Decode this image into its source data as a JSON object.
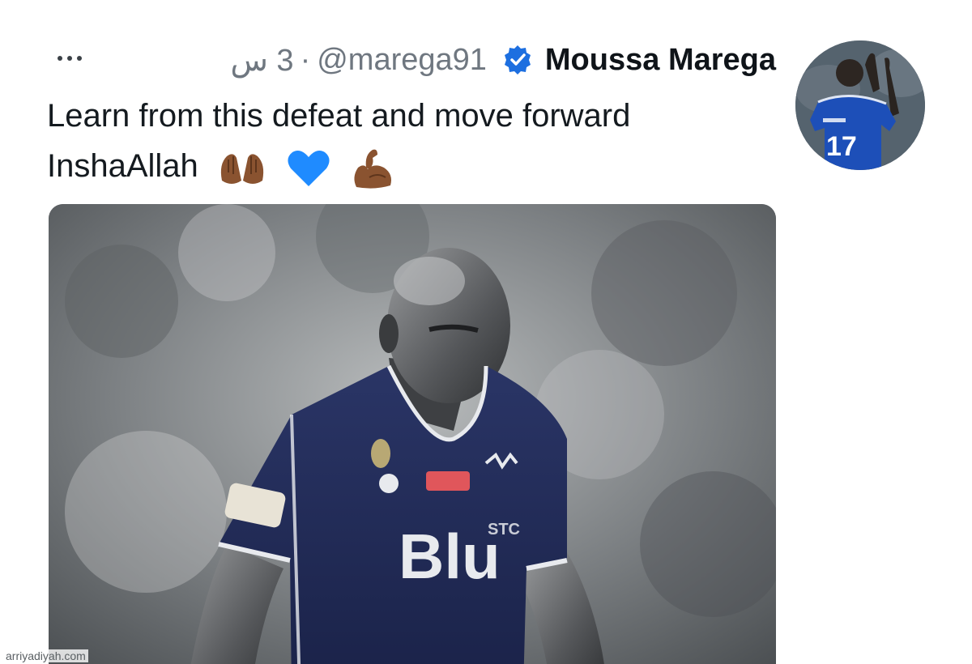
{
  "tweet": {
    "display_name": "Moussa Marega",
    "handle": "@marega91",
    "separator": "·",
    "time": "3 س",
    "text_line1": "Learn from this defeat and move forward",
    "text_line2": "InshaAllah",
    "emojis": [
      "praying-hands-emoji",
      "blue-heart-emoji",
      "flexed-biceps-emoji"
    ]
  },
  "avatar": {
    "jersey_number": "17"
  },
  "media": {
    "jersey_sponsor": "Blu",
    "jersey_sponsor_label": "STC"
  },
  "watermark": "arriyadiyah.com",
  "colors": {
    "verified_blue": "#1d6fe0",
    "jersey_navy": "#1f2a56",
    "blue_heart": "#1f8bff"
  }
}
